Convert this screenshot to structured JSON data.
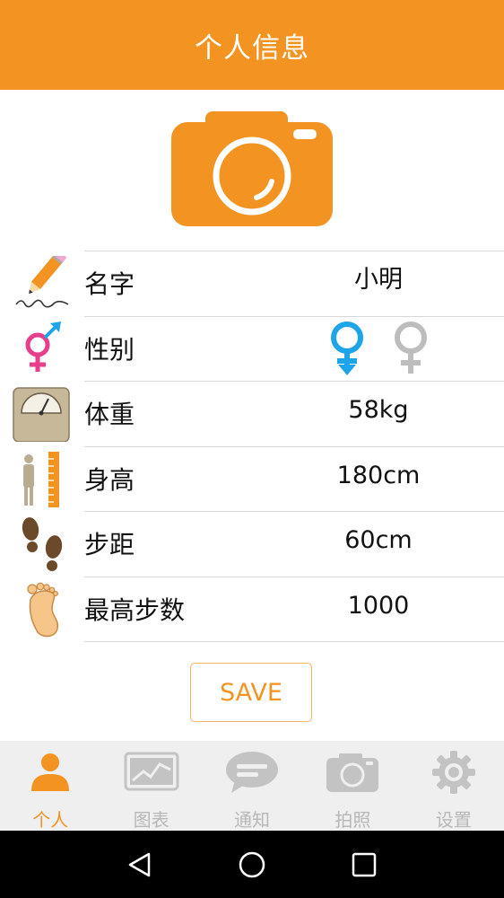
{
  "header": {
    "title": "个人信息"
  },
  "camera": {
    "icon": "camera-icon"
  },
  "rows": [
    {
      "key": "name",
      "label": "名字",
      "value": "小明",
      "icon": "pencil-signature-icon"
    },
    {
      "key": "gender",
      "label": "性别",
      "icon": "gender-icon",
      "options": [
        "male",
        "female"
      ],
      "selected": "male"
    },
    {
      "key": "weight",
      "label": "体重",
      "value": "58kg",
      "icon": "scale-icon"
    },
    {
      "key": "height",
      "label": "身高",
      "value": "180cm",
      "icon": "height-ruler-icon"
    },
    {
      "key": "stride",
      "label": "步距",
      "value": "60cm",
      "icon": "footprints-icon"
    },
    {
      "key": "max_steps",
      "label": "最高步数",
      "value": "1000",
      "icon": "foot-icon"
    }
  ],
  "save_label": "SAVE",
  "tabs": [
    {
      "label": "个人",
      "icon": "person-icon",
      "active": true
    },
    {
      "label": "图表",
      "icon": "chart-icon",
      "active": false
    },
    {
      "label": "通知",
      "icon": "chat-bubble-icon",
      "active": false
    },
    {
      "label": "拍照",
      "icon": "camera-icon",
      "active": false
    },
    {
      "label": "设置",
      "icon": "gear-icon",
      "active": false
    }
  ],
  "colors": {
    "accent": "#f39322",
    "male": "#1ea5e9",
    "female": "#e83e8c",
    "inactive": "#bdbdbd"
  }
}
